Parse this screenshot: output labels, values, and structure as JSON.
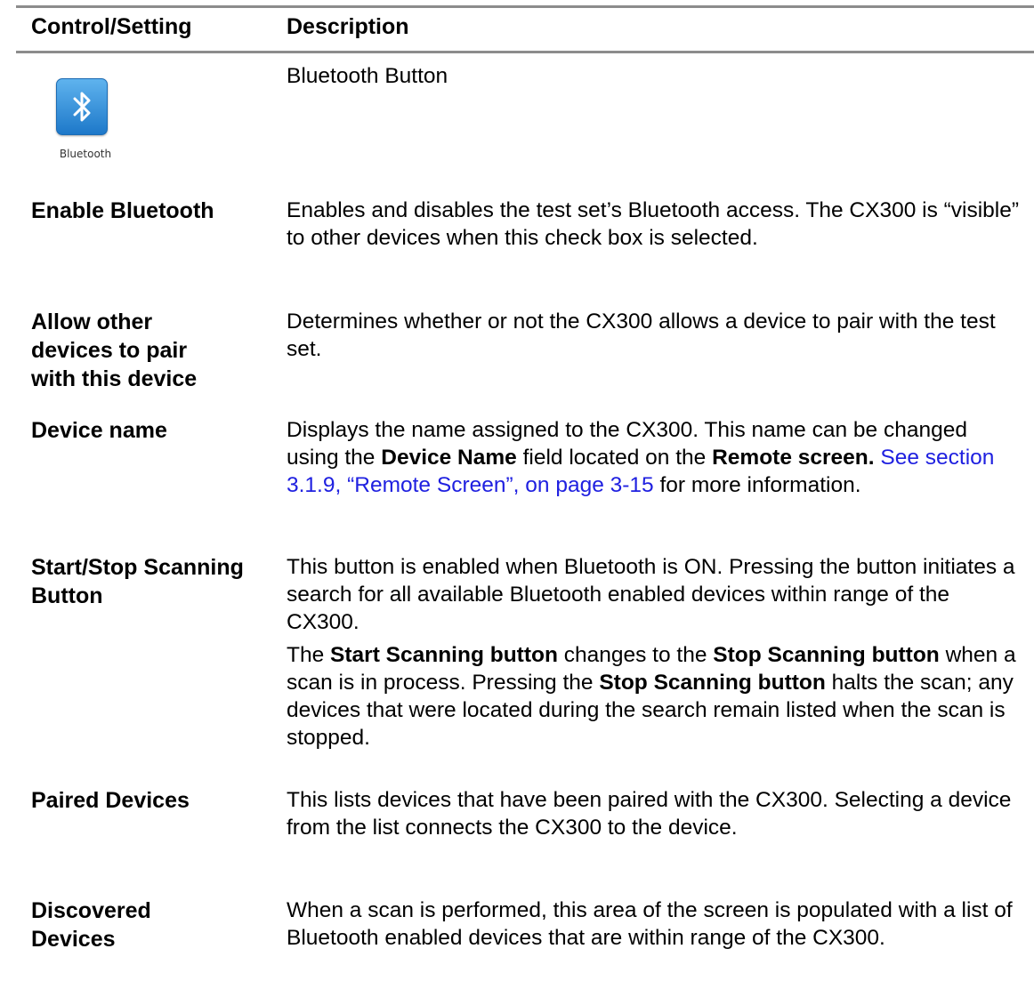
{
  "table": {
    "headers": {
      "control": "Control/Setting",
      "description": "Description"
    },
    "rows": [
      {
        "icon_name": "bluetooth-icon",
        "icon_caption": "Bluetooth",
        "description": "Bluetooth Button"
      },
      {
        "label": "Enable Bluetooth",
        "description": "Enables and disables the test set’s Bluetooth access. The CX300 is “visible” to other devices when this check box is selected."
      },
      {
        "label": "Allow other devices to pair with this device",
        "description": "Determines whether or not the CX300 allows a device to pair with the test set."
      },
      {
        "label": "Device name",
        "description": {
          "part1": "Displays the name assigned to the CX300. This name can be changed using the ",
          "bold1": "Device Name",
          "part2": " field located on the ",
          "bold2": "Remote screen.",
          "link": " See section 3.1.9, “Remote Screen”, on page 3-15",
          "part3": " for more information."
        }
      },
      {
        "label": "Start/Stop Scanning Button",
        "description": {
          "para1": "This button is enabled when Bluetooth is ON. Pressing the button initiates a search for all available Bluetooth enabled devices within range of the CX300.",
          "p2_a": "The ",
          "p2_b1": "Start Scanning button",
          "p2_c": " changes to the ",
          "p2_b2": "Stop Scanning button",
          "p2_d": " when a scan is in process. Pressing the ",
          "p2_b3": "Stop Scanning button",
          "p2_e": " halts the scan; any devices that were located during the search remain listed when the scan is stopped."
        }
      },
      {
        "label": "Paired Devices",
        "description": "This lists devices that have been paired with the CX300. Selecting a device from the list connects the CX300 to the device."
      },
      {
        "label": "Discovered Devices",
        "description": "When a scan is performed, this area of the screen is populated with a list of Bluetooth enabled devices that are within range of the CX300."
      }
    ]
  }
}
